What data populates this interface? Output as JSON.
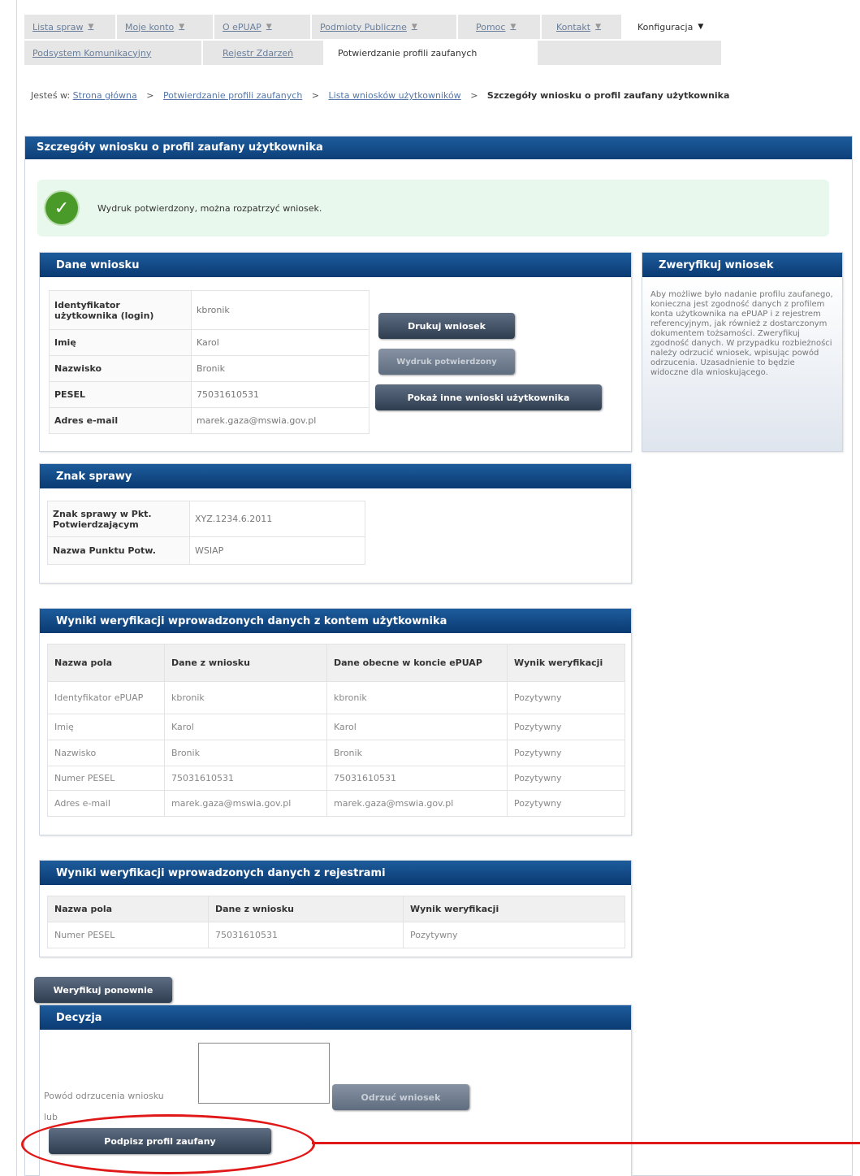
{
  "nav": {
    "row1": [
      {
        "label": "Lista spraw",
        "caret": "▼"
      },
      {
        "label": "Moje konto",
        "caret": "▼"
      },
      {
        "label": "O ePUAP",
        "caret": "▼"
      },
      {
        "label": "Podmioty Publiczne",
        "caret": "▼"
      },
      {
        "label": "Pomoc",
        "caret": "▼"
      },
      {
        "label": "Kontakt",
        "caret": "▼"
      },
      {
        "label": "Konfiguracja",
        "caret": "▼"
      }
    ],
    "row2": [
      {
        "label": "Podsystem Komunikacyjny"
      },
      {
        "label": "Rejestr Zdarzeń"
      },
      {
        "label": "Potwierdzanie profili zaufanych"
      }
    ]
  },
  "breadcrumb": {
    "prefix": "Jesteś w:",
    "links": [
      "Strona główna",
      "Potwierdzanie profili zaufanych",
      "Lista wniosków użytkowników"
    ],
    "separator": ">",
    "current": "Szczegóły wniosku o profil zaufany użytkownika"
  },
  "page_title": "Szczegóły wniosku o profil zaufany użytkownika",
  "alert": {
    "icon": "check-icon",
    "text": "Wydruk potwierdzony, można rozpatrzyć wniosek."
  },
  "dane_wniosku": {
    "title": "Dane wniosku",
    "rows": [
      {
        "key": "Identyfikator użytkownika (login)",
        "value": "kbronik"
      },
      {
        "key": "Imię",
        "value": "Karol"
      },
      {
        "key": "Nazwisko",
        "value": "Bronik"
      },
      {
        "key": "PESEL",
        "value": "75031610531"
      },
      {
        "key": "Adres e-mail",
        "value": "marek.gaza@mswia.gov.pl"
      }
    ],
    "buttons": {
      "print": "Drukuj wniosek",
      "printed": "Wydruk potwierdzony",
      "show_other": "Pokaż inne wnioski użytkownika"
    }
  },
  "zweryfikuj": {
    "title": "Zweryfikuj wniosek",
    "text": "Aby możliwe było nadanie profilu zaufanego, konieczna jest zgodność danych z profilem konta użytkownika na ePUAP i z rejestrem referencyjnym, jak również z dostarczonym dokumentem tożsamości. Zweryfikuj zgodność danych. W przypadku rozbieżności należy odrzucić wniosek, wpisując powód odrzucenia. Uzasadnienie to będzie widoczne dla wnioskującego."
  },
  "znak_sprawy": {
    "title": "Znak sprawy",
    "rows": [
      {
        "key": "Znak sprawy w Pkt. Potwierdzającym",
        "value": "XYZ.1234.6.2011"
      },
      {
        "key": "Nazwa Punktu Potw.",
        "value": "WSIAP"
      }
    ]
  },
  "wyniki_konto": {
    "title": "Wyniki weryfikacji wprowadzonych danych z kontem użytkownika",
    "headers": [
      "Nazwa pola",
      "Dane z wniosku",
      "Dane obecne w koncie ePUAP",
      "Wynik weryfikacji"
    ],
    "rows": [
      [
        "Identyfikator ePUAP",
        "kbronik",
        "kbronik",
        "Pozytywny"
      ],
      [
        "Imię",
        "Karol",
        "Karol",
        "Pozytywny"
      ],
      [
        "Nazwisko",
        "Bronik",
        "Bronik",
        "Pozytywny"
      ],
      [
        "Numer PESEL",
        "75031610531",
        "75031610531",
        "Pozytywny"
      ],
      [
        "Adres e-mail",
        "marek.gaza@mswia.gov.pl",
        "marek.gaza@mswia.gov.pl",
        "Pozytywny"
      ]
    ]
  },
  "wyniki_rejestry": {
    "title": "Wyniki weryfikacji wprowadzonych danych z rejestrami",
    "headers": [
      "Nazwa pola",
      "Dane z wniosku",
      "Wynik weryfikacji"
    ],
    "rows": [
      [
        "Numer PESEL",
        "75031610531",
        "Pozytywny"
      ]
    ]
  },
  "verify_again": "Weryfikuj ponownie",
  "decyzja": {
    "title": "Decyzja",
    "reason_label": "Powód odrzucenia wniosku",
    "reject_button": "Odrzuć wniosek",
    "lub": "lub",
    "sign_button": "Podpisz profil zaufany"
  },
  "colors": {
    "header_blue": "#0d3f78",
    "button_dark": "#2f3d50",
    "alert_bg": "#e9f8ec",
    "success_green": "#4a9a2a",
    "annotation_red": "#e01818"
  }
}
